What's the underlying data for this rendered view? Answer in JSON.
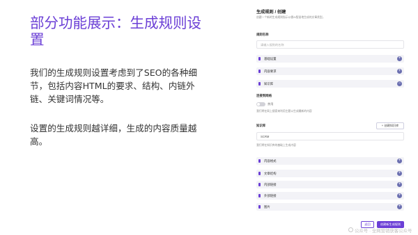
{
  "slide": {
    "title": "部分功能展示：生成规则设置",
    "paragraphs": [
      "我们的生成规则设置考虑到了SEO的各种细节，包括内容HTML的要求、结构、内链外链、关键词情况等。",
      "设置的生成规则越详细，生成的内容质量越高。"
    ]
  },
  "form": {
    "title": "生成规则 / 创建",
    "subtitle": "创建一个新的生成规则指示以便AI智慧地生成的文章类型。",
    "name_label": "规则名称",
    "name_placeholder": "请输入规则的名称",
    "sections_top": [
      "基础设置",
      "内容要求",
      "知识库"
    ],
    "web_label": "连接到网络",
    "toggle_label": "禁用",
    "web_hint": "我们将在网上搜索来利用主题以生成最新的内容",
    "kb_label": "知识库",
    "add_kb_button": "+ 创建知识库",
    "kb_select_value": "SCRM",
    "kb_hint": "我们将在知识库的基础上生成内容",
    "sections_bottom": [
      "内容格式",
      "文章结构",
      "内部链接",
      "外部链接",
      "图片"
    ],
    "back_button": "返回",
    "create_button": "创建新生成规则"
  },
  "watermark": "公众号 · 全网营销获客公众号"
}
